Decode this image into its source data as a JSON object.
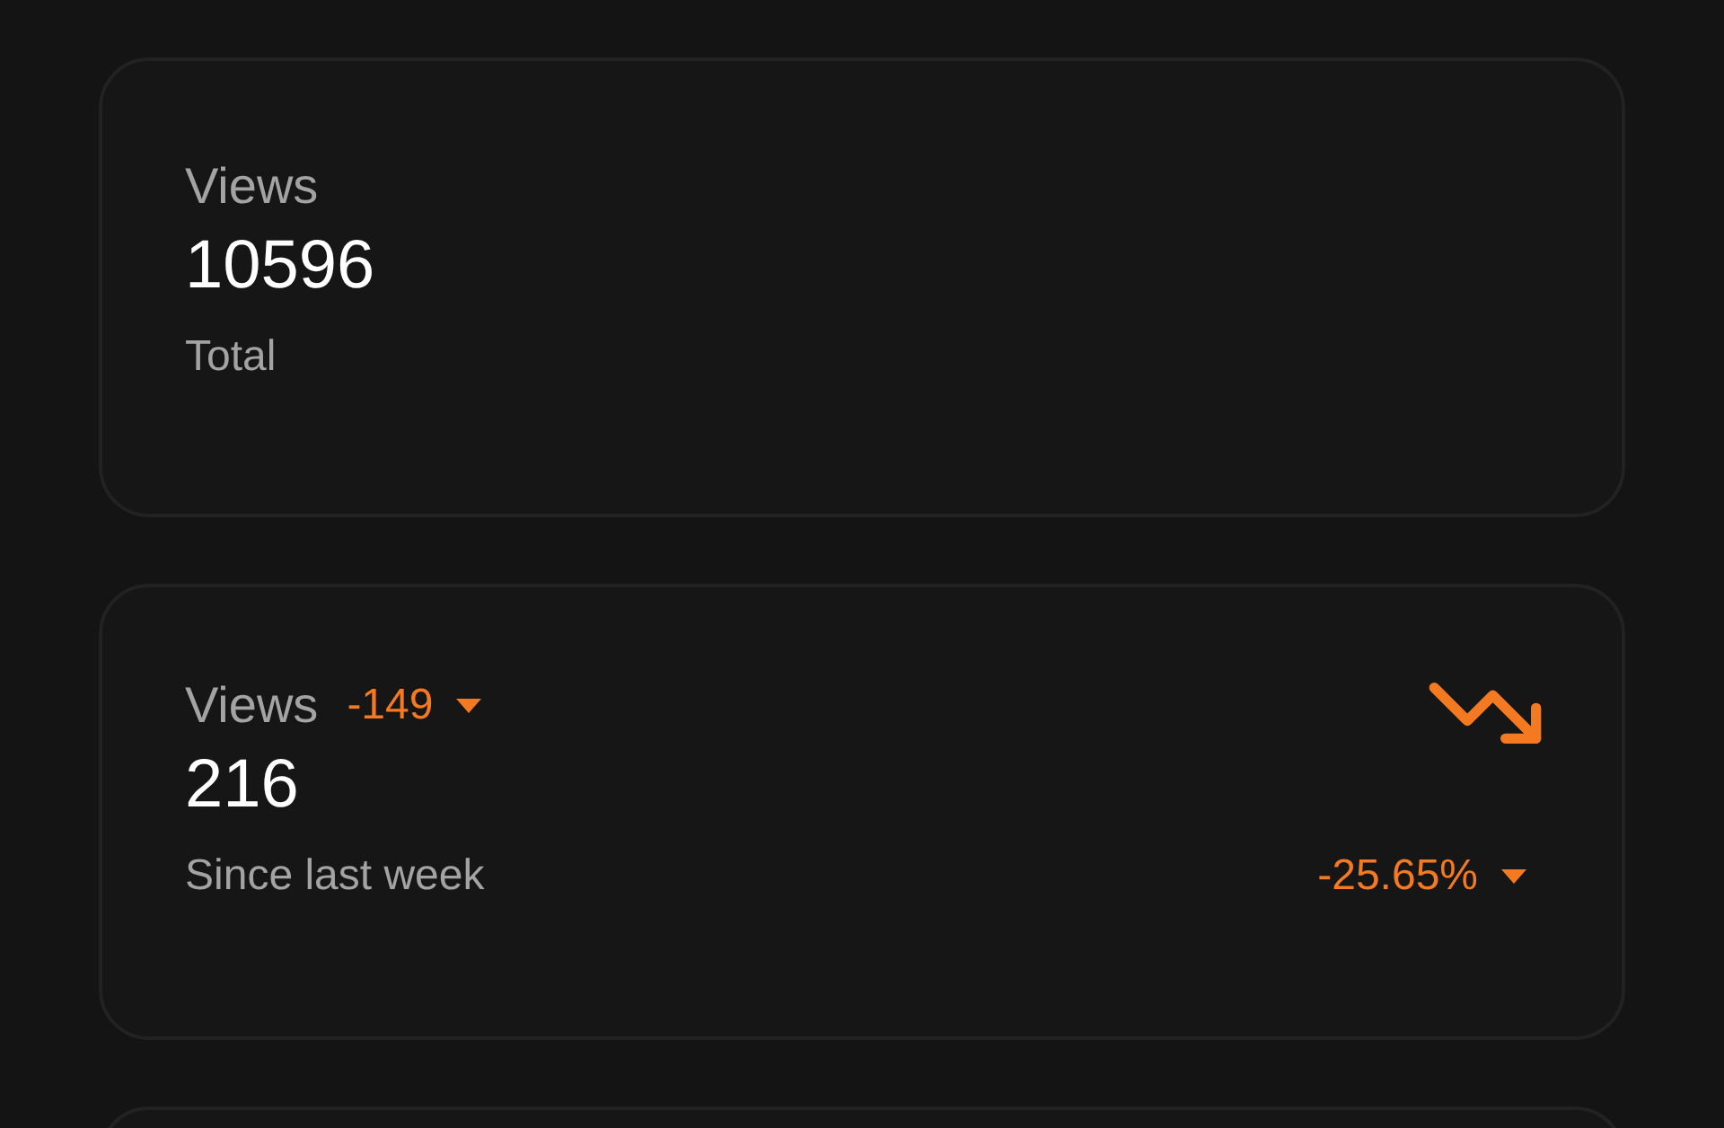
{
  "cards": [
    {
      "kind": "total",
      "label": "Views",
      "value": "10596",
      "caption": "Total"
    },
    {
      "kind": "change",
      "label": "Views",
      "delta": "-149",
      "value": "216",
      "caption": "Since last week",
      "percent": "-25.65%",
      "decreasing": true
    },
    {
      "kind": "empty"
    }
  ]
}
